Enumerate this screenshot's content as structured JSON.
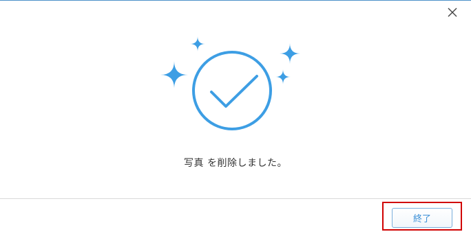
{
  "dialog": {
    "message": "写真 を削除しました。",
    "finish_button_label": "終了",
    "accent_color": "#3d9ee4",
    "highlight_color": "#d00000"
  },
  "icons": {
    "close": "close-icon",
    "success": "success-check-icon",
    "sparkles": "sparkle-icon"
  }
}
